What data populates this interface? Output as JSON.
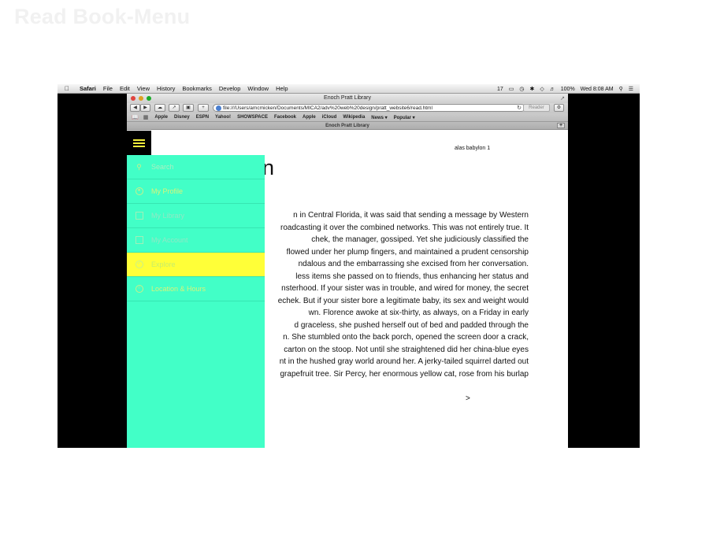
{
  "slide_title": "Read Book-Menu",
  "menubar": {
    "apple_icon": "apple-icon",
    "app_name": "Safari",
    "items": [
      "File",
      "Edit",
      "View",
      "History",
      "Bookmarks",
      "Develop",
      "Window",
      "Help"
    ],
    "right_items": [
      "17",
      "100%",
      "Wed 8:08 AM"
    ]
  },
  "window": {
    "title": "Enoch Pratt Library",
    "url": "file:///Users/amcmicken/Documents/MICA2/adv%20web%20design/pratt_website6/read.html",
    "reader_label": "Reader",
    "bookmarks": [
      "Apple",
      "Disney",
      "ESPN",
      "Yahoo!",
      "SHOWSPACE",
      "Facebook",
      "Apple",
      "iCloud",
      "Wikipedia",
      "News ▾",
      "Popular ▾"
    ],
    "tab_title": "Enoch Pratt Library"
  },
  "page": {
    "book_label": "alas babylon 1",
    "book_title_visible": "rlon",
    "text_lines": [
      "n in Central Florida, it was said that sending a message by Western",
      "roadcasting it over the combined networks. This was not entirely true. It",
      "chek, the manager, gossiped. Yet she judiciously classified the",
      "flowed under her plump fingers, and maintained a prudent censorship",
      "ndalous and the embarrassing she excised from her conversation.",
      "less items she passed on to friends, thus enhancing her status and",
      "nsterhood. If your sister was in trouble, and wired for money, the secret",
      "echek. But if your sister bore a legitimate baby, its sex and weight would",
      "wn. Florence awoke at six-thirty, as always, on a Friday in early",
      "d graceless, she pushed herself out of bed and padded through the",
      "n. She stumbled onto the back porch, opened the screen door a crack,",
      "carton on the stoop. Not until she straightened did her china-blue eyes",
      "nt in the hushed gray world around her. A jerky-tailed squirrel darted out",
      "grapefruit tree. Sir Percy, her enormous yellow cat, rose from his burlap"
    ],
    "next_label": ">"
  },
  "menu": {
    "items": [
      {
        "label": "Search",
        "icon": "search-icon"
      },
      {
        "label": "My Profile",
        "icon": "profile-icon"
      },
      {
        "label": "My Library",
        "icon": "library-icon"
      },
      {
        "label": "My Account",
        "icon": "account-icon"
      },
      {
        "label": "Explore",
        "icon": "explore-icon"
      },
      {
        "label": "Location & Hours",
        "icon": "location-icon"
      }
    ],
    "active_index": 4
  },
  "colors": {
    "menu_bg": "#42ffc7",
    "menu_active": "#ffff38",
    "hamburger_bg": "#000000",
    "hamburger_lines": "#f2ee3c"
  }
}
